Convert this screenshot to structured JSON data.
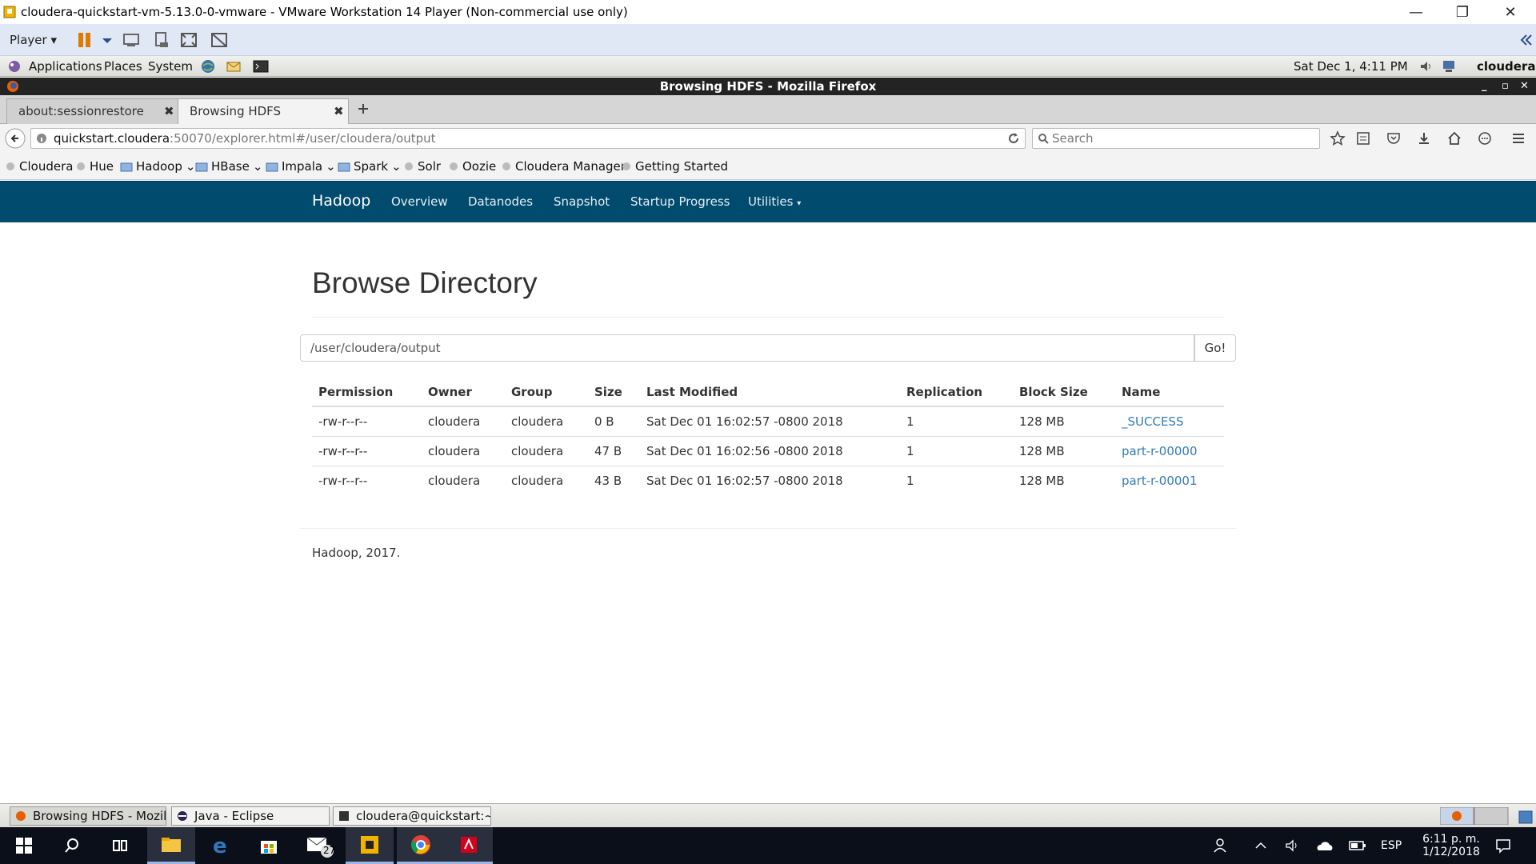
{
  "vmware": {
    "title": "cloudera-quickstart-vm-5.13.0-0-vmware - VMware Workstation 14 Player (Non-commercial use only)",
    "player_label": "Player"
  },
  "gnome": {
    "applications": "Applications",
    "places": "Places",
    "system": "System",
    "datetime": "Sat Dec  1,  4:11 PM",
    "user": "cloudera"
  },
  "firefox": {
    "window_title": "Browsing HDFS - Mozilla Firefox",
    "tabs": [
      {
        "label": "about:sessionrestore"
      },
      {
        "label": "Browsing HDFS"
      }
    ],
    "url_host": "quickstart.cloudera",
    "url_rest": ":50070/explorer.html#/user/cloudera/output",
    "search_placeholder": "Search",
    "bookmarks": [
      {
        "label": "Cloudera",
        "type": "site"
      },
      {
        "label": "Hue",
        "type": "site"
      },
      {
        "label": "Hadoop",
        "type": "folder"
      },
      {
        "label": "HBase",
        "type": "folder"
      },
      {
        "label": "Impala",
        "type": "folder"
      },
      {
        "label": "Spark",
        "type": "folder"
      },
      {
        "label": "Solr",
        "type": "site"
      },
      {
        "label": "Oozie",
        "type": "site"
      },
      {
        "label": "Cloudera Manager",
        "type": "site"
      },
      {
        "label": "Getting Started",
        "type": "site"
      }
    ]
  },
  "hadoop": {
    "brand": "Hadoop",
    "nav": [
      "Overview",
      "Datanodes",
      "Snapshot",
      "Startup Progress",
      "Utilities"
    ],
    "page_title": "Browse Directory",
    "dir_value": "/user/cloudera/output",
    "go_label": "Go!",
    "columns": [
      "Permission",
      "Owner",
      "Group",
      "Size",
      "Last Modified",
      "Replication",
      "Block Size",
      "Name"
    ],
    "rows": [
      {
        "permission": "-rw-r--r--",
        "owner": "cloudera",
        "group": "cloudera",
        "size": "0 B",
        "modified": "Sat Dec 01 16:02:57 -0800 2018",
        "replication": "1",
        "block_size": "128 MB",
        "name": "_SUCCESS"
      },
      {
        "permission": "-rw-r--r--",
        "owner": "cloudera",
        "group": "cloudera",
        "size": "47 B",
        "modified": "Sat Dec 01 16:02:56 -0800 2018",
        "replication": "1",
        "block_size": "128 MB",
        "name": "part-r-00000"
      },
      {
        "permission": "-rw-r--r--",
        "owner": "cloudera",
        "group": "cloudera",
        "size": "43 B",
        "modified": "Sat Dec 01 16:02:57 -0800 2018",
        "replication": "1",
        "block_size": "128 MB",
        "name": "part-r-00001"
      }
    ],
    "footer": "Hadoop, 2017."
  },
  "bottom_panel": {
    "tasks": [
      "Browsing HDFS - Mozil...",
      "Java - Eclipse",
      "cloudera@quickstart:~"
    ]
  },
  "windows": {
    "mail_badge": "27",
    "language": "ESP",
    "time": "6:11 p. m.",
    "date": "1/12/2018"
  },
  "colors": {
    "hadoop_nav": "#004b6e",
    "link": "#337ab7"
  }
}
